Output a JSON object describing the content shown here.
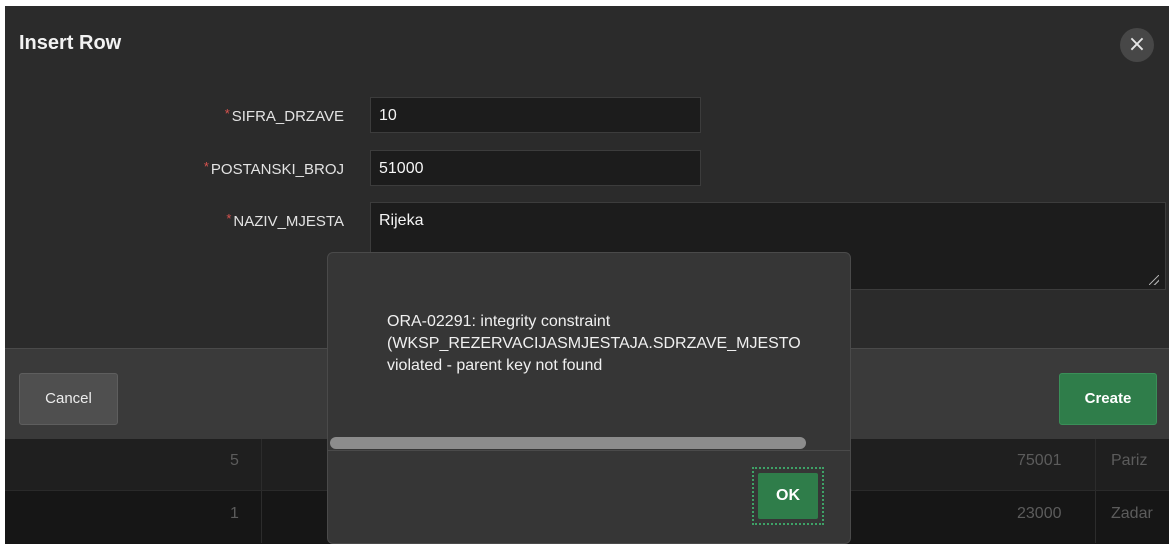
{
  "dialog": {
    "title": "Insert Row",
    "close_icon": "×",
    "fields": [
      {
        "label": "SIFRA_DRZAVE",
        "value": "10",
        "required": "*"
      },
      {
        "label": "POSTANSKI_BROJ",
        "value": "51000",
        "required": "*"
      },
      {
        "label": "NAZIV_MJESTA",
        "value": "Rijeka",
        "required": "*"
      }
    ],
    "cancel_label": "Cancel",
    "create_label": "Create"
  },
  "alert": {
    "message": "ORA-02291: integrity constraint\n(WKSP_REZERVACIJASMJESTAJA.SDRZAVE_MJESTO\nviolated - parent key not found",
    "ok_label": "OK"
  },
  "grid": {
    "rows": [
      {
        "id": "5",
        "code": "75001",
        "name": "Pariz"
      },
      {
        "id": "1",
        "code": "23000",
        "name": "Zadar"
      }
    ]
  },
  "colors": {
    "accent": "#2f7d4a",
    "required": "#d9534f",
    "dialog_bg": "#2b2b2b"
  }
}
